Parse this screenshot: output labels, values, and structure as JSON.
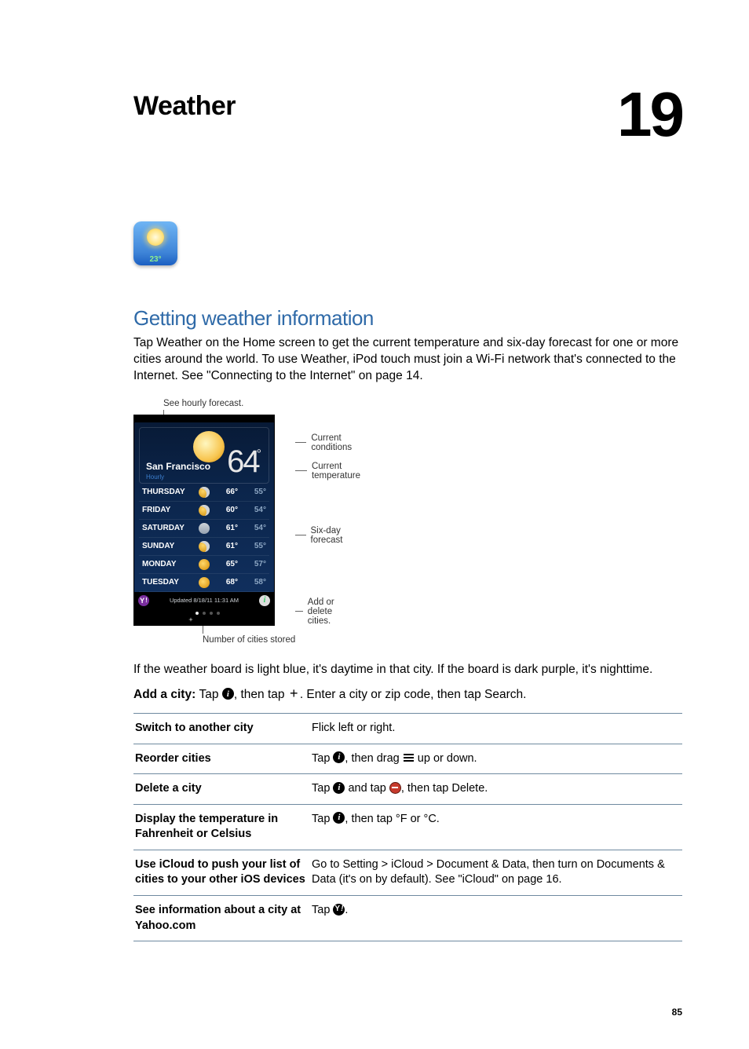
{
  "chapter": {
    "title": "Weather",
    "number": "19"
  },
  "app_icon": {
    "badge": "23°"
  },
  "section": {
    "heading": "Getting weather information",
    "intro": "Tap Weather on the Home screen to get the current temperature and six-day forecast for one or more cities around the world. To use Weather, iPod touch must join a Wi-Fi network that's connected to the Internet. See \"Connecting to the Internet\" on page 14."
  },
  "figure": {
    "hourly_callout": "See hourly forecast.",
    "city": "San Francisco",
    "hourly_label": "Hourly",
    "current_temp": "64",
    "updated": "Updated 8/18/11  11:31 AM",
    "forecast": [
      {
        "day": "THURSDAY",
        "icon": "psun",
        "hi": "66°",
        "lo": "55°"
      },
      {
        "day": "FRIDAY",
        "icon": "psun",
        "hi": "60°",
        "lo": "54°"
      },
      {
        "day": "SATURDAY",
        "icon": "rain",
        "hi": "61°",
        "lo": "54°"
      },
      {
        "day": "SUNDAY",
        "icon": "psun",
        "hi": "61°",
        "lo": "55°"
      },
      {
        "day": "MONDAY",
        "icon": "sun",
        "hi": "65°",
        "lo": "57°"
      },
      {
        "day": "TUESDAY",
        "icon": "sun",
        "hi": "68°",
        "lo": "58°"
      }
    ],
    "callouts": {
      "current_conditions": "Current conditions",
      "current_temperature": "Current temperature",
      "six_day": "Six-day forecast",
      "add_delete": "Add or delete cities.",
      "number_stored": "Number of cities stored"
    }
  },
  "after_figure": "If the weather board is light blue, it's daytime in that city. If the board is dark purple, it's nighttime.",
  "add_city": {
    "label": "Add a city:  ",
    "part1": "Tap ",
    "part2": ", then tap ",
    "part3": ". Enter a city or zip code, then tap Search."
  },
  "table": {
    "rows": [
      {
        "left": "Switch to another city",
        "right_parts": [
          "Flick left or right."
        ]
      },
      {
        "left": "Reorder cities",
        "right_parts": [
          "Tap ",
          "ICON_I",
          ", then drag ",
          "ICON_HAMBURGER",
          " up or down."
        ]
      },
      {
        "left": "Delete a city",
        "right_parts": [
          "Tap ",
          "ICON_I",
          " and tap ",
          "ICON_MINUS",
          ", then tap Delete."
        ]
      },
      {
        "left": "Display the temperature in Fahrenheit or Celsius",
        "right_parts": [
          "Tap ",
          "ICON_I",
          ", then tap °F or °C."
        ]
      },
      {
        "left": "Use iCloud to push your list of cities to your other iOS devices",
        "right_parts": [
          "Go to Setting > iCloud > Document & Data, then turn on Documents & Data (it's on by default). See \"iCloud\" on page 16."
        ]
      },
      {
        "left": "See information about a city at Yahoo.com",
        "right_parts": [
          "Tap ",
          "ICON_YAHOO",
          "."
        ]
      }
    ]
  },
  "page_number": "85"
}
